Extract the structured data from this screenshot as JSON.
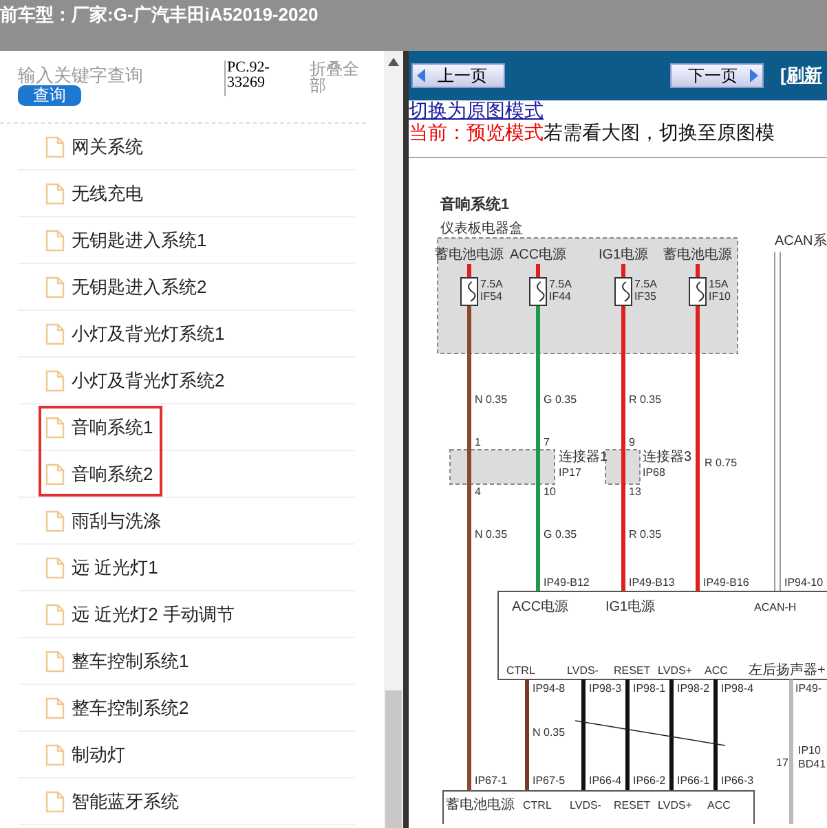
{
  "header": {
    "title": "前车型：厂家:G-广汽丰田iA52019-2020"
  },
  "sidebar": {
    "search": {
      "placeholder": "输入关键字查询",
      "button": "查询"
    },
    "code": "PC.92-33269",
    "collapse": "折叠全部",
    "items": [
      {
        "label": "网关系统",
        "highlighted": false
      },
      {
        "label": "无线充电",
        "highlighted": false
      },
      {
        "label": "无钥匙进入系统1",
        "highlighted": false
      },
      {
        "label": "无钥匙进入系统2",
        "highlighted": false
      },
      {
        "label": "小灯及背光灯系统1",
        "highlighted": false
      },
      {
        "label": "小灯及背光灯系统2",
        "highlighted": false
      },
      {
        "label": "音响系统1",
        "highlighted": true
      },
      {
        "label": "音响系统2",
        "highlighted": true
      },
      {
        "label": "雨刮与洗涤",
        "highlighted": false
      },
      {
        "label": "远 近光灯1",
        "highlighted": false
      },
      {
        "label": "远 近光灯2 手动调节",
        "highlighted": false
      },
      {
        "label": "整车控制系统1",
        "highlighted": false
      },
      {
        "label": "整车控制系统2",
        "highlighted": false
      },
      {
        "label": "制动灯",
        "highlighted": false
      },
      {
        "label": "智能蓝牙系统",
        "highlighted": false
      }
    ]
  },
  "viewer": {
    "prev": "上一页",
    "next": "下一页",
    "refresh": "[刷新",
    "mode_link": "切换为原图模式",
    "mode_status": "当前：预览模式",
    "mode_hint": "若需看大图，切换至原图模",
    "diagram": {
      "title": "音响系统1",
      "box_label": "仪表板电器盒",
      "side_label": "ACAN系",
      "fuse_circuits": [
        {
          "source": "蓄电池电源",
          "rating": "7.5A",
          "code": "IF54",
          "color": "#8b4a2b",
          "wire_label": "N 0.35",
          "pin_in": "1",
          "pin_out": "4",
          "wire_label_2": "N 0.35",
          "terminal": "IP67-1"
        },
        {
          "source": "ACC电源",
          "rating": "7.5A",
          "code": "IF44",
          "color": "#1a9a4a",
          "wire_label": "G 0.35",
          "pin_in": "7",
          "pin_out": "10",
          "wire_label_2": "G 0.35",
          "terminal": "IP49-B12"
        },
        {
          "source": "IG1电源",
          "rating": "7.5A",
          "code": "IF35",
          "color": "#e0201e",
          "wire_label": "R 0.35",
          "pin_in": "9",
          "pin_out": "13",
          "wire_label_2": "R 0.35",
          "terminal": "IP49-B13"
        },
        {
          "source": "蓄电池电源",
          "rating": "15A",
          "code": "IF10",
          "color": "#e0201e",
          "wire_label": "R 0.75",
          "terminal": "IP49-B16"
        }
      ],
      "connectors": [
        {
          "name": "连接器1",
          "code": "IP17"
        },
        {
          "name": "连接器3",
          "code": "IP68"
        }
      ],
      "acan_terminal": "IP94-10",
      "module": {
        "top_pins": [
          "ACC电源",
          "IG1电源",
          "ACAN-H"
        ],
        "bottom_pins": [
          "CTRL",
          "LVDS-",
          "RESET",
          "LVDS+",
          "ACC",
          "左后扬声器+"
        ]
      },
      "signal_wires": [
        {
          "top": "IP94-8",
          "bottom": "IP67-5",
          "color": "#7a3a2a"
        },
        {
          "top": "IP98-3",
          "bottom": "IP66-4",
          "color": "#111111"
        },
        {
          "top": "IP98-1",
          "bottom": "IP66-2",
          "color": "#111111"
        },
        {
          "top": "IP98-2",
          "bottom": "IP66-1",
          "color": "#111111"
        },
        {
          "top": "IP98-4",
          "bottom": "IP66-3",
          "color": "#111111"
        }
      ],
      "signal_wire_label": "N 0.35",
      "side_wire": {
        "terminal": "IP49-",
        "pin": "17",
        "connector": "IP10",
        "code": "BD41"
      },
      "display": {
        "pins": [
          "蓄电池电源",
          "CTRL",
          "LVDS-",
          "RESET",
          "LVDS+",
          "ACC"
        ]
      }
    }
  }
}
